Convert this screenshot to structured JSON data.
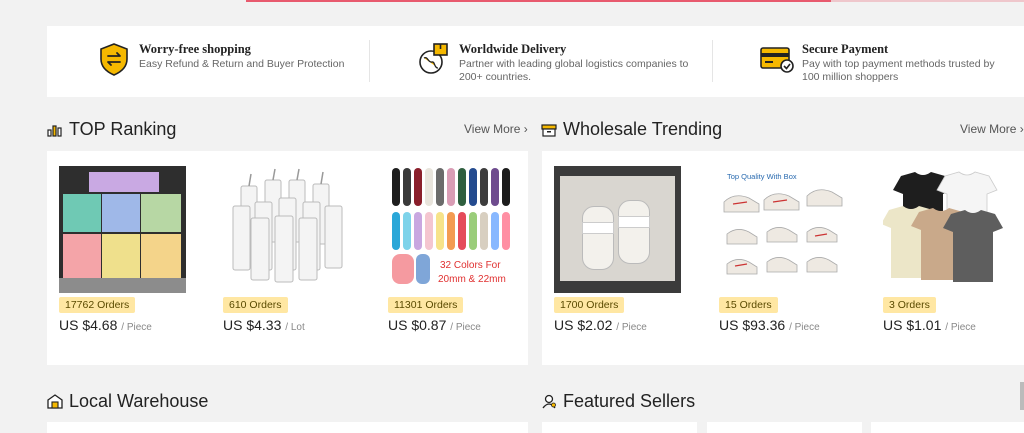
{
  "benefits": [
    {
      "title": "Worry-free shopping",
      "desc": "Easy Refund & Return and Buyer Protection",
      "icon": "shield-exchange-icon"
    },
    {
      "title": "Worldwide Delivery",
      "desc": "Partner with leading global logistics companies to 200+ countries.",
      "icon": "globe-box-icon"
    },
    {
      "title": "Secure Payment",
      "desc": "Pay with top payment methods trusted by 100 million shoppers",
      "icon": "credit-card-check-icon"
    }
  ],
  "top_ranking": {
    "title": "TOP Ranking",
    "view_more": "View More ›",
    "products": [
      {
        "orders": "17762 Orders",
        "price": "US $4.68",
        "unit": "/ Piece"
      },
      {
        "orders": "610 Orders",
        "price": "US $4.33",
        "unit": "/ Lot"
      },
      {
        "orders": "11301 Orders",
        "price": "US $0.87",
        "unit": "/ Piece",
        "img_text_1": "32 Colors For",
        "img_text_2": "20mm & 22mm"
      }
    ]
  },
  "wholesale": {
    "title": "Wholesale Trending",
    "view_more": "View More ›",
    "products": [
      {
        "orders": "1700 Orders",
        "price": "US $2.02",
        "unit": "/ Piece"
      },
      {
        "orders": "15 Orders",
        "price": "US $93.36",
        "unit": "/ Piece",
        "img_text_1": "Top Quality With Box"
      },
      {
        "orders": "3 Orders",
        "price": "US $1.01",
        "unit": "/ Piece"
      }
    ]
  },
  "local_warehouse": {
    "title": "Local Warehouse"
  },
  "featured_sellers": {
    "title": "Featured Sellers"
  },
  "colors": {
    "accent": "#e85a6e",
    "badge": "#ffe7a3",
    "icon_yellow": "#f5b800"
  }
}
